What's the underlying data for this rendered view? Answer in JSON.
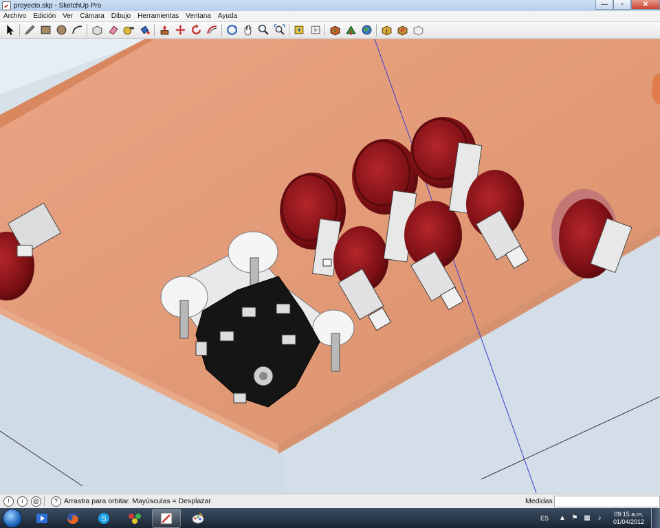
{
  "window": {
    "title": "proyecto.skp - SketchUp Pro",
    "minimize": "—",
    "maximize": "▫",
    "close": "✕"
  },
  "menu": [
    "Archivo",
    "Edición",
    "Ver",
    "Cámara",
    "Dibujo",
    "Herramientas",
    "Ventana",
    "Ayuda"
  ],
  "toolbar": {
    "tools": [
      {
        "icon": "select-arrow-icon"
      },
      {
        "icon": "sep"
      },
      {
        "icon": "pencil-line-icon"
      },
      {
        "icon": "rectangle-icon"
      },
      {
        "icon": "circle-icon"
      },
      {
        "icon": "arc-icon"
      },
      {
        "icon": "sep"
      },
      {
        "icon": "make-component-icon"
      },
      {
        "icon": "eraser-icon"
      },
      {
        "icon": "tape-measure-icon"
      },
      {
        "icon": "paint-bucket-icon"
      },
      {
        "icon": "sep"
      },
      {
        "icon": "push-pull-icon"
      },
      {
        "icon": "move-icon"
      },
      {
        "icon": "rotate-icon"
      },
      {
        "icon": "offset-icon"
      },
      {
        "icon": "sep"
      },
      {
        "icon": "orbit-icon"
      },
      {
        "icon": "pan-hand-icon"
      },
      {
        "icon": "zoom-icon"
      },
      {
        "icon": "zoom-extents-icon"
      },
      {
        "icon": "sep"
      },
      {
        "icon": "previous-view-icon"
      },
      {
        "icon": "next-view-icon"
      },
      {
        "icon": "sep"
      },
      {
        "icon": "get-models-icon"
      },
      {
        "icon": "share-model-icon"
      },
      {
        "icon": "google-earth-icon"
      },
      {
        "icon": "sep"
      },
      {
        "icon": "get-components-icon"
      },
      {
        "icon": "share-component-icon"
      },
      {
        "icon": "extension-icon"
      }
    ]
  },
  "status": {
    "hint": "Arrastra para orbitar. Mayúsculas = Desplazar",
    "measure_label": "Medidas",
    "measure_value": "",
    "help_icon": "?",
    "info_icon_1": "!",
    "info_icon_2": "i",
    "info_icon_3": "@"
  },
  "taskbar": {
    "language": "ES",
    "time": "09:15 a.m.",
    "date": "01/04/2012",
    "apps": [
      "media-player-icon",
      "firefox-icon",
      "skype-icon",
      "network-icon",
      "sketchup-icon",
      "paint-icon"
    ]
  }
}
